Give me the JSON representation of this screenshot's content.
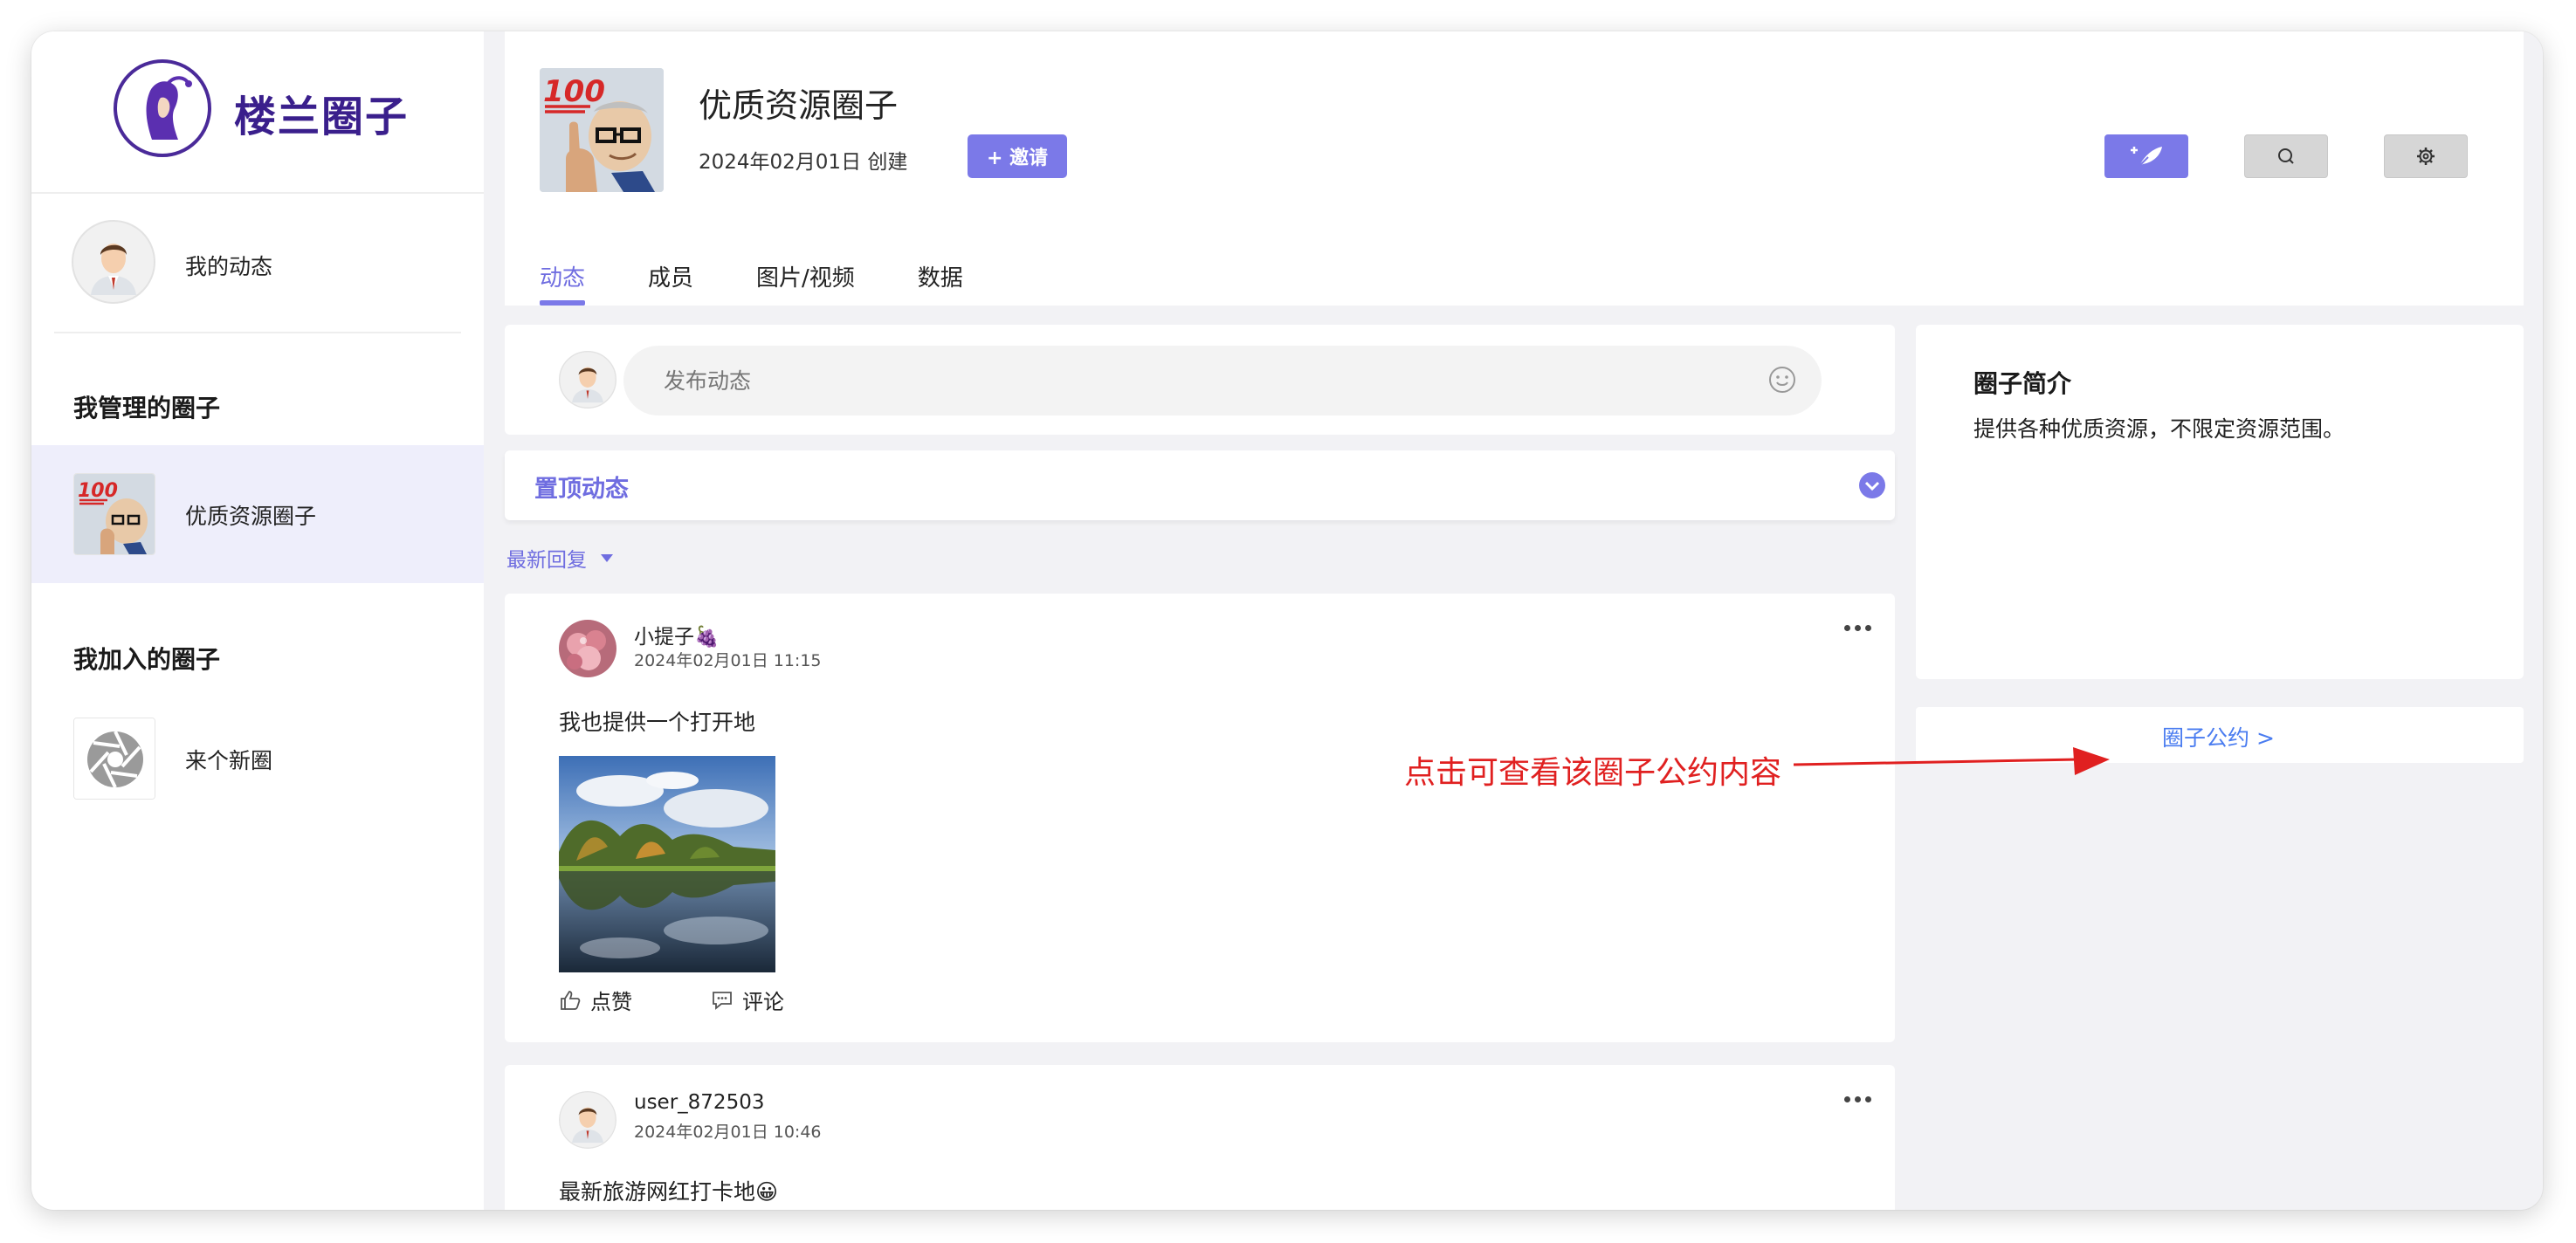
{
  "brand": {
    "name": "楼兰圈子"
  },
  "sidebar": {
    "my_feed": "我的动态",
    "managed_title": "我管理的圈子",
    "managed": [
      {
        "label": "优质资源圈子"
      }
    ],
    "joined_title": "我加入的圈子",
    "joined": [
      {
        "label": "来个新圈"
      }
    ]
  },
  "circle": {
    "title": "优质资源圈子",
    "created": "2024年02月01日 创建",
    "invite_label": "+ 邀请"
  },
  "tabs": [
    {
      "label": "动态",
      "active": true
    },
    {
      "label": "成员",
      "active": false
    },
    {
      "label": "图片/视频",
      "active": false
    },
    {
      "label": "数据",
      "active": false
    }
  ],
  "composer": {
    "placeholder": "发布动态"
  },
  "pinned": {
    "label": "置顶动态"
  },
  "sort": {
    "label": "最新回复"
  },
  "posts": [
    {
      "author": "小提子🍇",
      "time": "2024年02月01日 11:15",
      "text": "我也提供一个打开地",
      "like_label": "点赞",
      "comment_label": "评论"
    },
    {
      "author": "user_872503",
      "time": "2024年02月01日 10:46",
      "text": "最新旅游网红打卡地😀"
    }
  ],
  "intro": {
    "title": "圈子简介",
    "desc": "提供各种优质资源，不限定资源范围。"
  },
  "rules": {
    "label": "圈子公约 >"
  },
  "annotation": {
    "text": "点击可查看该圈子公约内容"
  },
  "colors": {
    "accent": "#7b79e8",
    "brand": "#3a1f8c",
    "link": "#4a7cf0",
    "annotation": "#e02020"
  }
}
